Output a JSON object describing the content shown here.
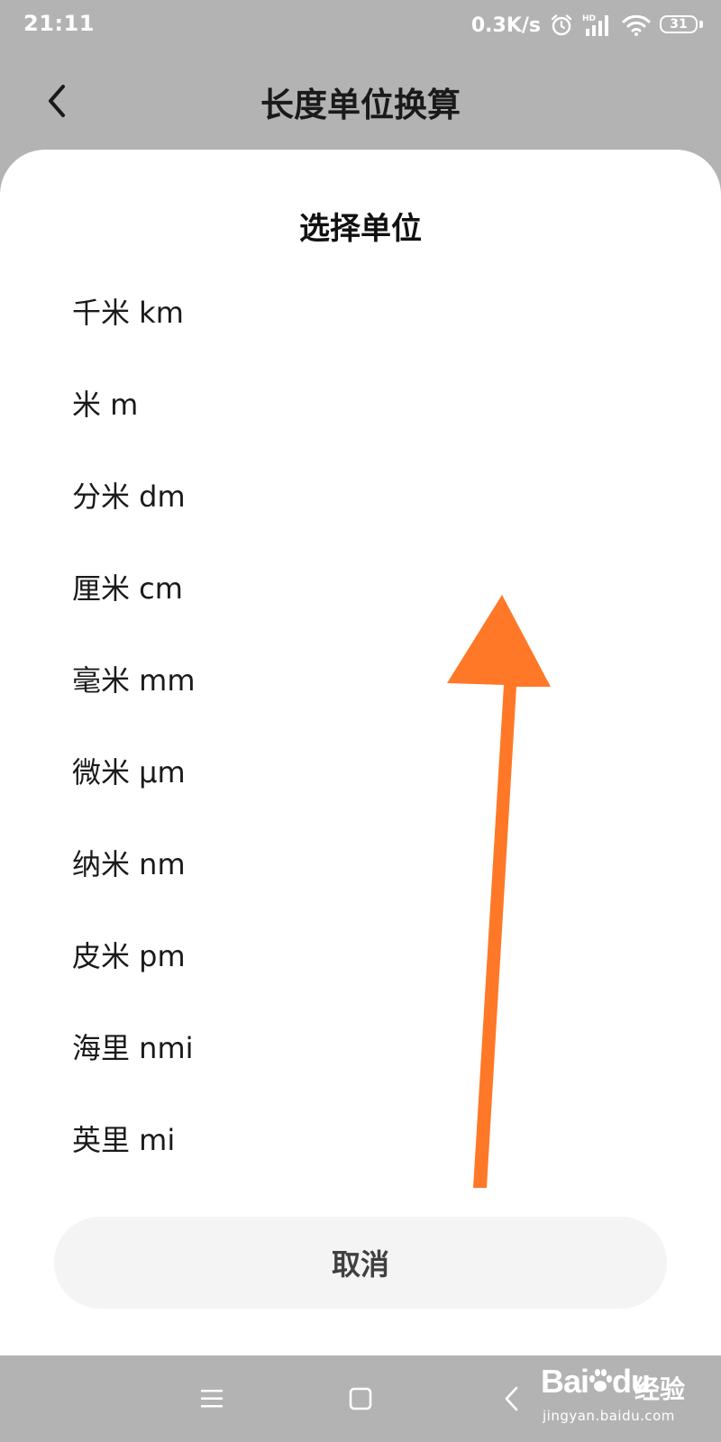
{
  "status_bar": {
    "time": "21:11",
    "net_speed": "0.3K/s",
    "alarm_icon": "alarm-clock-icon",
    "signal_icon": "hd-signal-icon",
    "signal_badge": "HD",
    "wifi_icon": "wifi-icon",
    "battery_level": "31"
  },
  "header": {
    "back_icon": "chevron-left-icon",
    "title": "长度单位换算"
  },
  "sheet": {
    "title": "选择单位",
    "units": [
      {
        "label": "千米 km"
      },
      {
        "label": "米 m"
      },
      {
        "label": "分米 dm"
      },
      {
        "label": "厘米 cm"
      },
      {
        "label": "毫米 mm"
      },
      {
        "label": "微米 μm"
      },
      {
        "label": "纳米 nm"
      },
      {
        "label": "皮米 pm"
      },
      {
        "label": "海里 nmi"
      },
      {
        "label": "英里 mi"
      }
    ],
    "cancel_label": "取消"
  },
  "annotation": {
    "arrow_color": "#ff7828",
    "direction": "up"
  },
  "nav_bar": {
    "menu_icon": "menu-icon",
    "home_icon": "square-home-icon",
    "back_icon": "chevron-left-icon"
  },
  "watermark": {
    "brand": "Bai",
    "brand_suffix": "du",
    "sub": "经验",
    "url": "jingyan.baidu.com"
  },
  "colors": {
    "background_dim": "#b3b3b3",
    "sheet": "#ffffff",
    "cancel_bg": "#f4f4f4",
    "text_primary": "#1a1a1a"
  }
}
